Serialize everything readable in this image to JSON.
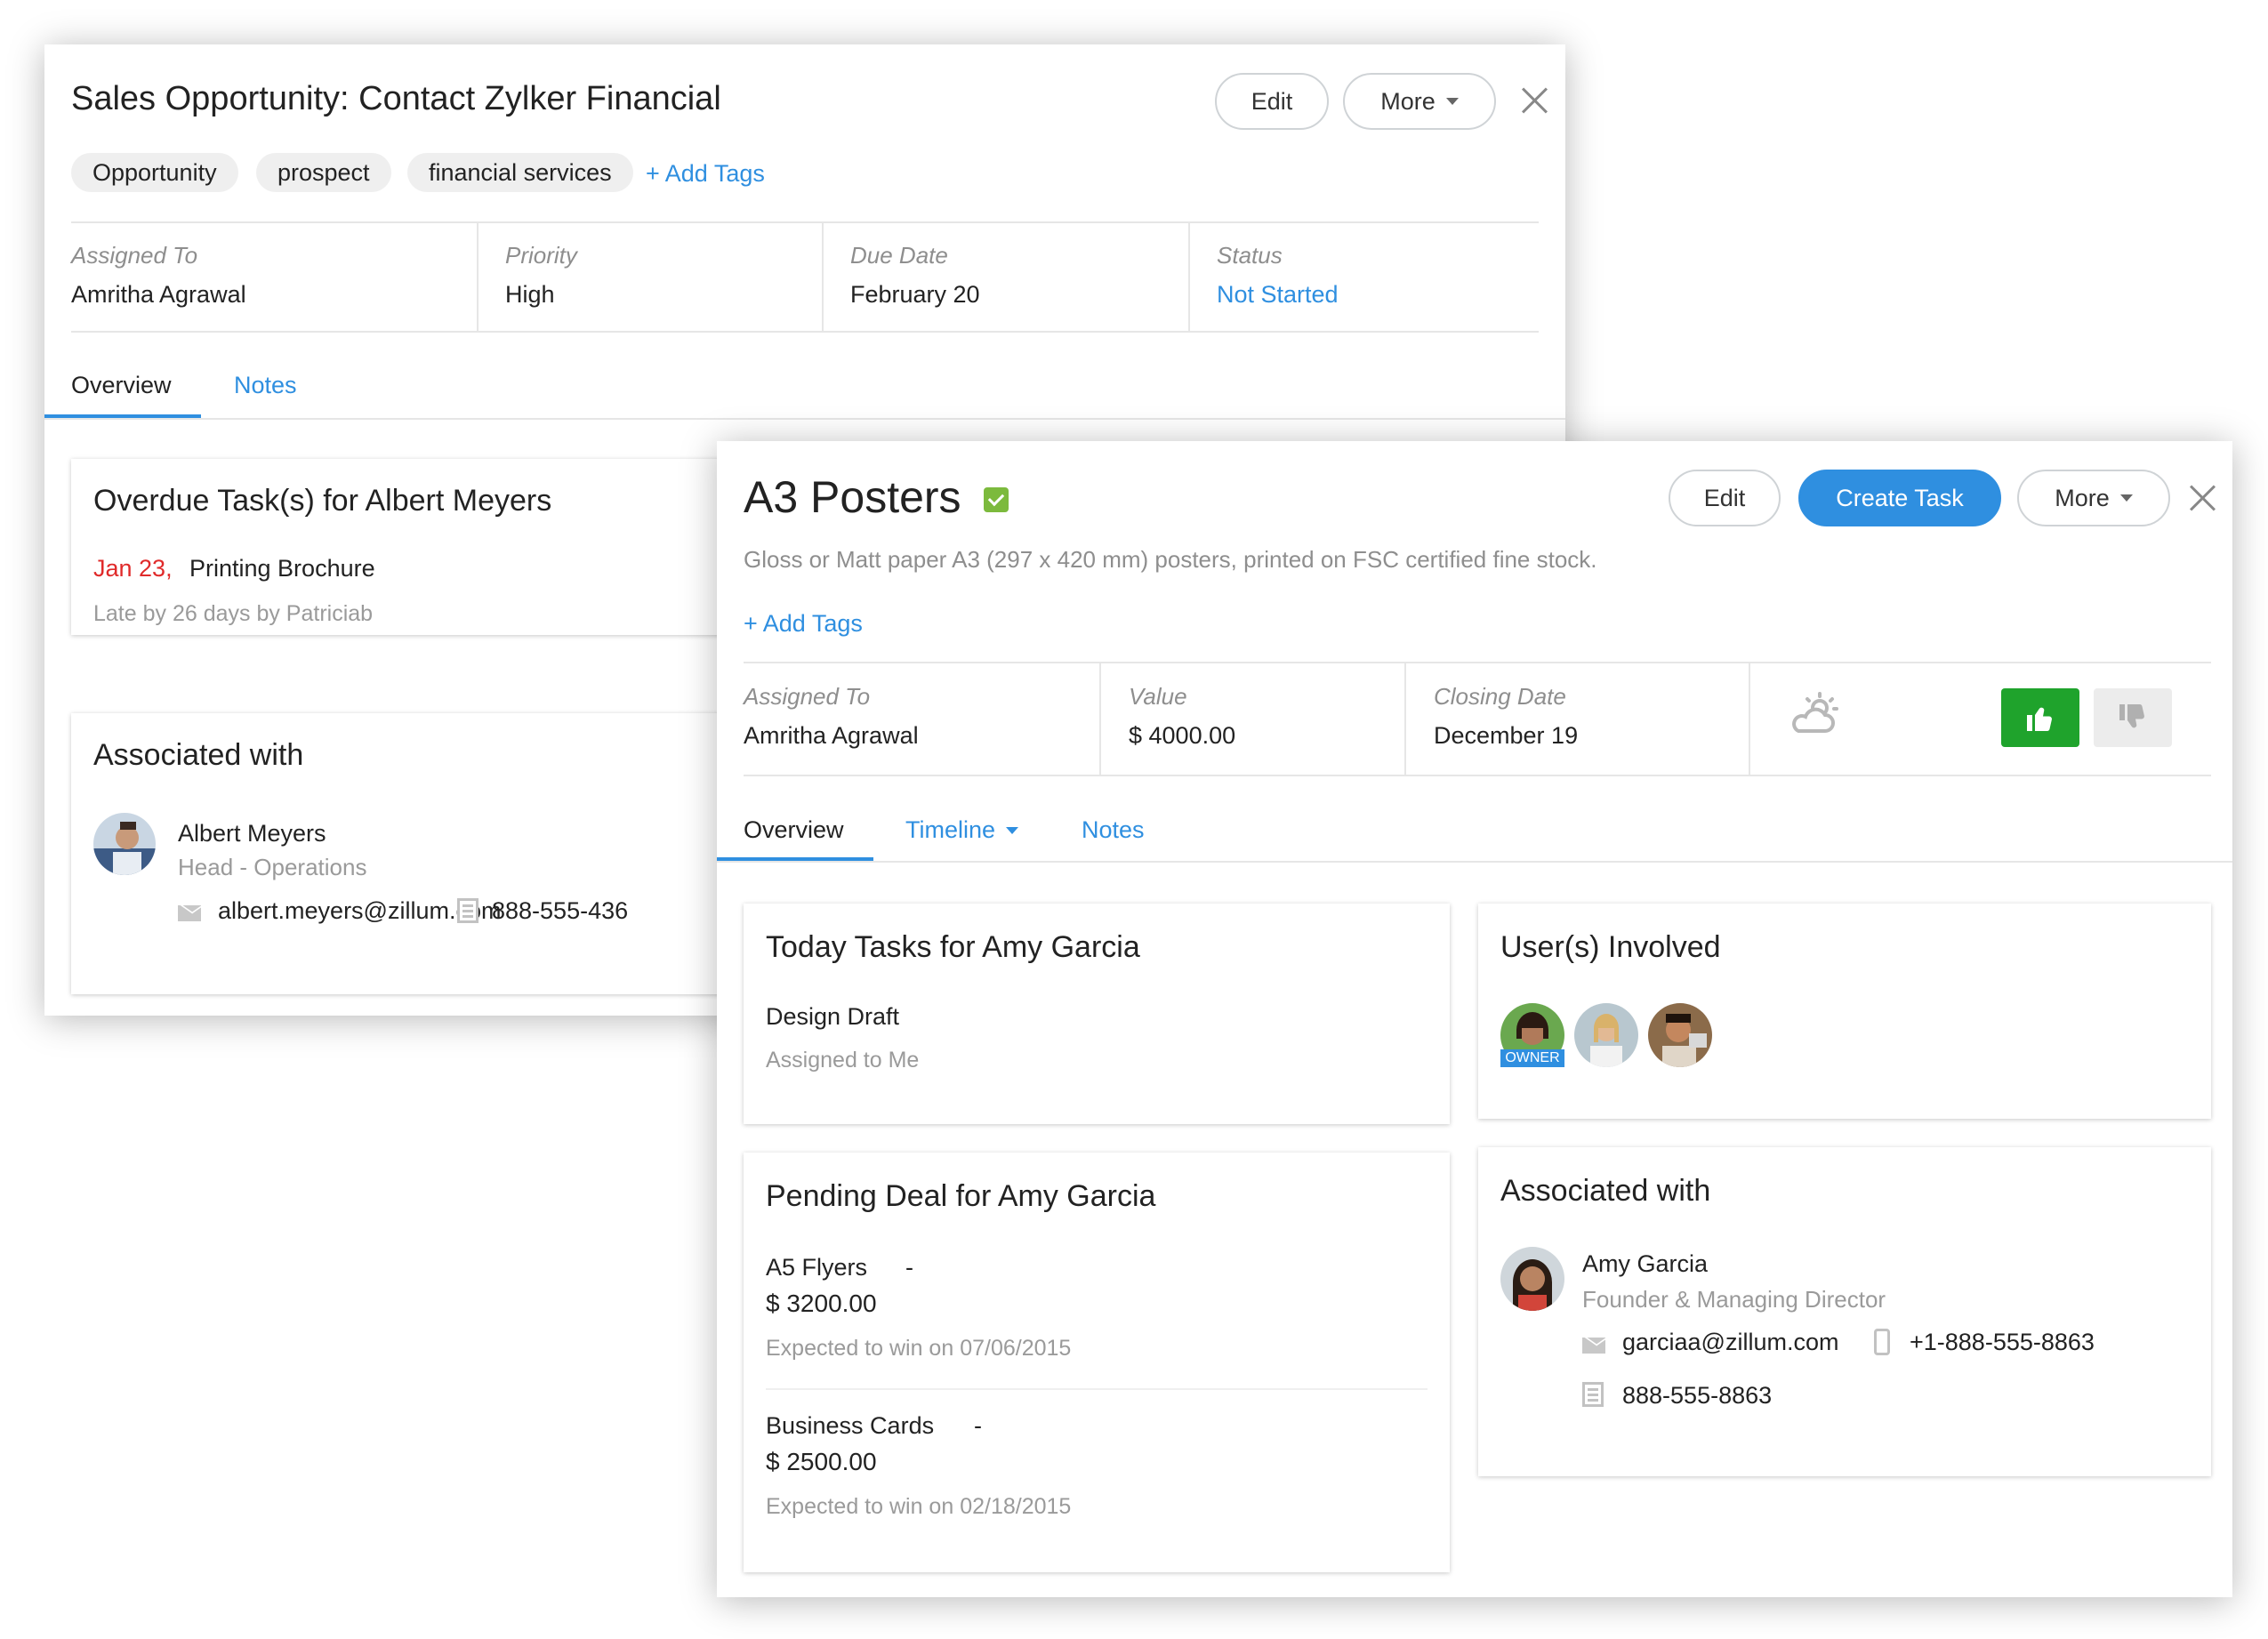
{
  "back_panel": {
    "title": "Sales Opportunity: Contact Zylker Financial",
    "edit_label": "Edit",
    "more_label": "More",
    "tags": [
      "Opportunity",
      "prospect",
      "financial services"
    ],
    "add_tags_label": "+ Add Tags",
    "fields": {
      "assigned_to": {
        "label": "Assigned To",
        "value": "Amritha Agrawal"
      },
      "priority": {
        "label": "Priority",
        "value": "High"
      },
      "due_date": {
        "label": "Due Date",
        "value": "February 20"
      },
      "status": {
        "label": "Status",
        "value": "Not Started"
      }
    },
    "tabs": [
      "Overview",
      "Notes"
    ],
    "overdue_card": {
      "title": "Overdue Task(s) for Albert Meyers",
      "date": "Jan 23,",
      "task": "Printing Brochure",
      "late_text": "Late by 26 days by Patriciab"
    },
    "associated_card": {
      "title": "Associated with",
      "name": "Albert Meyers",
      "role": "Head - Operations",
      "email": "albert.meyers@zillum.com",
      "phone": "888-555-436"
    }
  },
  "front_panel": {
    "title": "A3 Posters",
    "edit_label": "Edit",
    "create_task_label": "Create Task",
    "more_label": "More",
    "description": "Gloss or Matt paper A3 (297 x 420 mm) posters, printed on FSC certified fine stock.",
    "add_tags_label": "+ Add Tags",
    "fields": {
      "assigned_to": {
        "label": "Assigned To",
        "value": "Amritha Agrawal"
      },
      "value": {
        "label": "Value",
        "value": "$ 4000.00"
      },
      "closing_date": {
        "label": "Closing Date",
        "value": "December 19"
      }
    },
    "tabs": [
      "Overview",
      "Timeline",
      "Notes"
    ],
    "today_tasks": {
      "title": "Today Tasks for Amy Garcia",
      "task": "Design Draft",
      "assigned": "Assigned to Me"
    },
    "users_involved": {
      "title": "User(s) Involved",
      "owner_badge": "OWNER"
    },
    "pending_deal": {
      "title": "Pending Deal for Amy Garcia",
      "deals": [
        {
          "name": "A5 Flyers",
          "dash": "-",
          "amount": "$ 3200.00",
          "expected": "Expected to win on 07/06/2015"
        },
        {
          "name": "Business Cards",
          "dash": "-",
          "amount": "$ 2500.00",
          "expected": "Expected to win on 02/18/2015"
        }
      ]
    },
    "associated": {
      "title": "Associated with",
      "name": "Amy Garcia",
      "role": "Founder & Managing Director",
      "email": "garciaa@zillum.com",
      "mobile": "+1-888-555-8863",
      "phone": "888-555-8863"
    }
  },
  "colors": {
    "accent": "#2f8fe0",
    "overdue": "#e02a2a",
    "like": "#1fa32c",
    "check": "#7cba3d"
  }
}
